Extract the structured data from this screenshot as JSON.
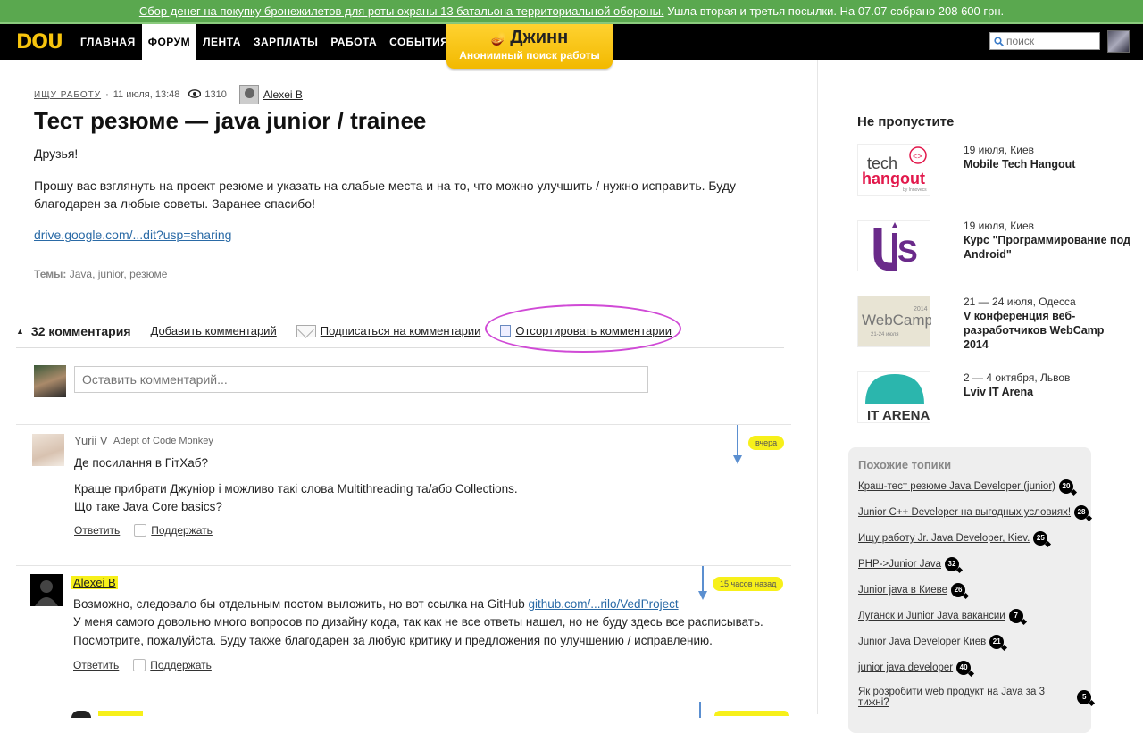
{
  "banner": {
    "link_text": "Сбор денег на покупку бронежилетов для роты охраны 13 батальона территориальной обороны.",
    "rest_text": "Ушла вторая и третья посылки. На 07.07 собрано 208 600 грн."
  },
  "nav": {
    "logo": "DOU",
    "items": [
      "ГЛАВНАЯ",
      "ФОРУМ",
      "ЛЕНТА",
      "ЗАРПЛАТЫ",
      "РАБОТА",
      "СОБЫТИЯ"
    ],
    "active": "ФОРУМ",
    "djinn_title": "Джинн",
    "djinn_sub": "Анонимный поиск работы",
    "search_placeholder": "поиск"
  },
  "post": {
    "category": "ИЩУ РАБОТУ",
    "date": "11 июля, 13:48",
    "views": "1310",
    "author": "Alexei B",
    "title": "Тест резюме — java junior / trainee",
    "greeting": "Друзья!",
    "body": "Прошу вас взглянуть на проект резюме и указать на слабые места и на то, что можно улучшить / нужно исправить. Буду благодарен за любые советы. Заранее спасибо!",
    "link": "drive.google.com/...dit?usp=sharing",
    "tags_label": "Темы:",
    "tags": "Java, junior, резюме"
  },
  "comments_bar": {
    "count": "32 комментария",
    "add": "Добавить комментарий",
    "subscribe": "Подписаться на комментарии",
    "sort": "Отсортировать комментарии"
  },
  "new_comment": {
    "placeholder": "Оставить комментарий..."
  },
  "comments": [
    {
      "name": "Yurii V",
      "role": "Adept of Code Monkey",
      "time": "вчера",
      "line1": "Де посилання в ГітХаб?",
      "line2": "Краще прибрати Джуніор і можливо такі слова Multithreading та/або Collections.",
      "line3": "Що таке Java Core basics?",
      "reply": "Ответить",
      "support": "Поддержать"
    },
    {
      "name": "Alexei B",
      "time": "15 часов назад",
      "line1_pre": "Возможно, следовало бы отдельным постом выложить, но вот ссылка на GitHub ",
      "line1_link": "github.com/...rilo/VedProject",
      "line2": "У меня самого довольно много вопросов по дизайну кода, так как не все ответы нашел, но не буду здесь все расписывать.",
      "line3": "Посмотрите, пожалуйста. Буду также благодарен за любую критику и предложения по улучшению / исправлению.",
      "reply": "Ответить",
      "support": "Поддержать"
    }
  ],
  "sidebar": {
    "heading": "Не пропустите",
    "events": [
      {
        "img_text": "tech hangout",
        "date": "19 июля, Киев",
        "title": "Mobile Tech Hangout"
      },
      {
        "img_text": "UJS",
        "date": "19 июля, Киев",
        "title": "Курс \"Программирование под Android\""
      },
      {
        "img_text": "WebCamp",
        "date": "21 — 24 июля, Одесса",
        "title": "V конференция веб-разработчиков WebCamp 2014"
      },
      {
        "img_text": "IT ARENA",
        "date": "2 — 4 октября, Львов",
        "title": "Lviv IT Arena"
      }
    ],
    "similar_heading": "Похожие топики",
    "topics": [
      {
        "title": "Краш-тест резюме Java Developer (junior)",
        "count": "20"
      },
      {
        "title": "Junior C++ Developer на выгодных условиях!",
        "count": "28"
      },
      {
        "title": "Ищу работу Jr. Java Developer, Kiev.",
        "count": "25"
      },
      {
        "title": "PHP->Junior Java",
        "count": "32"
      },
      {
        "title": "Junior java в Киеве",
        "count": "26"
      },
      {
        "title": "Луганск и Junior Java вакансии",
        "count": "7"
      },
      {
        "title": "Junior Java Developer Киев",
        "count": "21"
      },
      {
        "title": "junior java developer",
        "count": "40"
      },
      {
        "title": "Як розробити web продукт на Java за 3 тижні?",
        "count": "5"
      }
    ]
  },
  "colors": {
    "banner": "#5aa84f",
    "accent": "#f7c40d",
    "highlight": "#f7f01a",
    "link": "#2a6aa6",
    "oval": "#d04ad6"
  }
}
